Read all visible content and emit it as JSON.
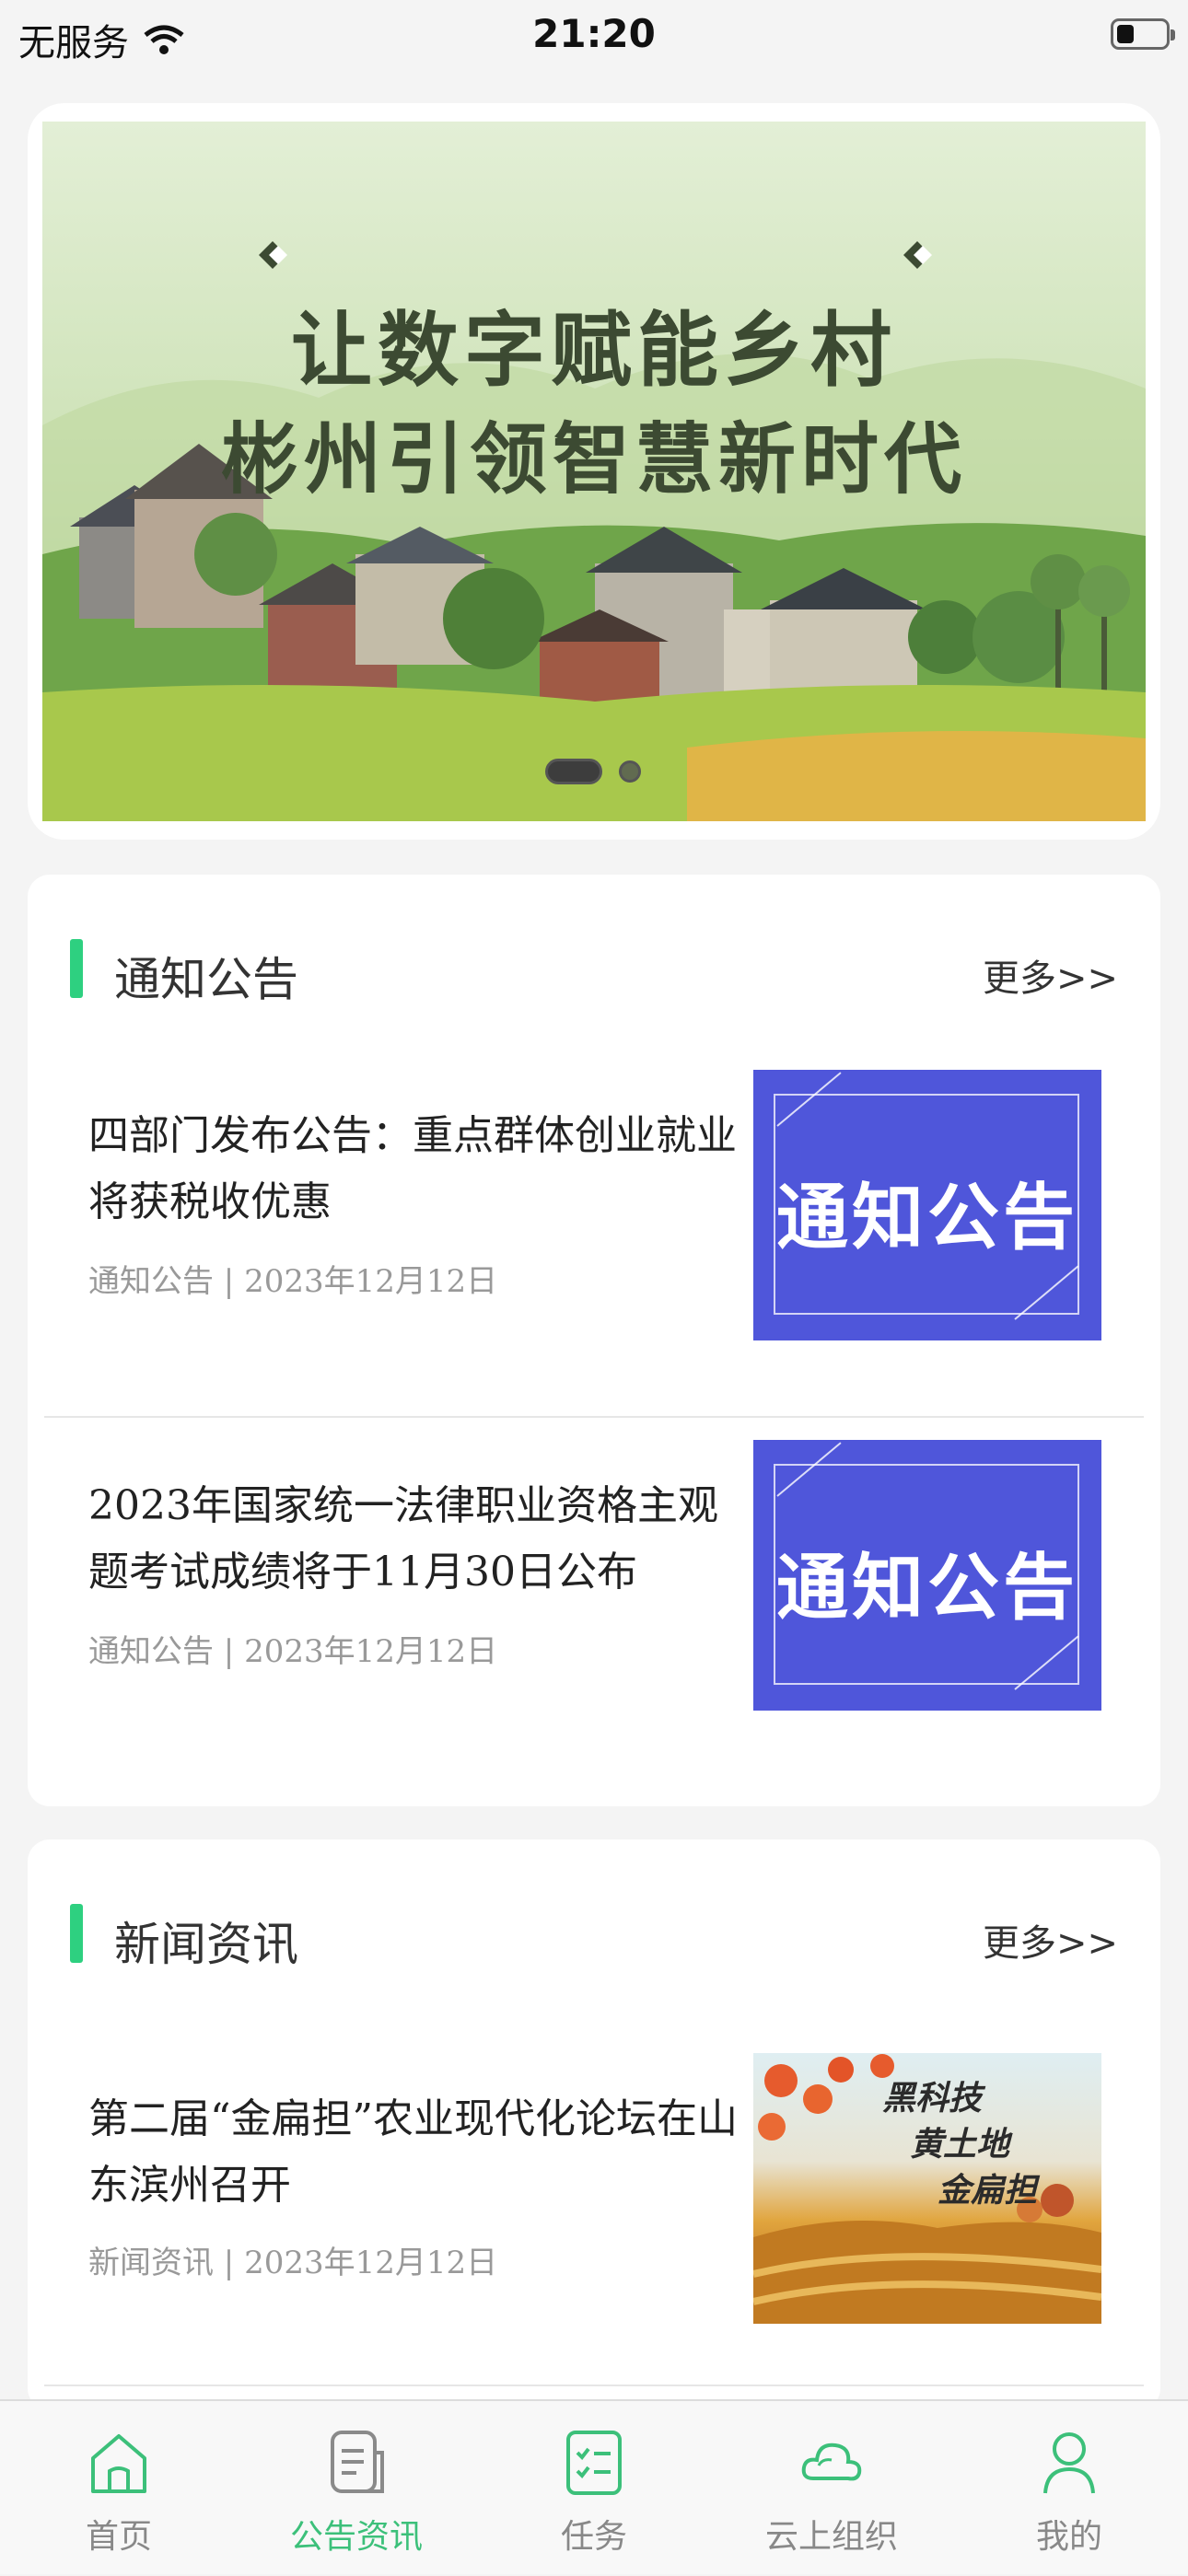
{
  "status_bar": {
    "carrier": "无服务",
    "time": "21:20"
  },
  "banner": {
    "line1": "让数字赋能乡村",
    "line2": "彬州引领智慧新时代",
    "current_slide": 1,
    "total_slides": 2
  },
  "notices": {
    "title": "通知公告",
    "more": "更多>>",
    "items": [
      {
        "title": "四部门发布公告：重点群体创业就业将获税收优惠",
        "meta": "通知公告 | 2023年12月12日",
        "image_text": "通知公告"
      },
      {
        "title": "2023年国家统一法律职业资格主观题考试成绩将于11月30日公布",
        "meta": "通知公告 | 2023年12月12日",
        "image_text": "通知公告"
      }
    ]
  },
  "news": {
    "title": "新闻资讯",
    "more": "更多>>",
    "items": [
      {
        "title": "第二届“金扁担”农业现代化论坛在山东滨州召开",
        "meta": "新闻资讯 | 2023年12月12日",
        "image_text": [
          "黑科技",
          "黄土地",
          "金扁担"
        ]
      }
    ]
  },
  "tabbar": {
    "items": [
      {
        "label": "首页",
        "icon": "home-icon",
        "active": false
      },
      {
        "label": "公告资讯",
        "icon": "document-icon",
        "active": true
      },
      {
        "label": "任务",
        "icon": "checklist-icon",
        "active": false
      },
      {
        "label": "云上组织",
        "icon": "cloud-icon",
        "active": false
      },
      {
        "label": "我的",
        "icon": "user-icon",
        "active": false
      }
    ]
  },
  "colors": {
    "accent": "#3cc07a",
    "section_marker": "#2ed080",
    "notice_image": "#4f56da"
  }
}
